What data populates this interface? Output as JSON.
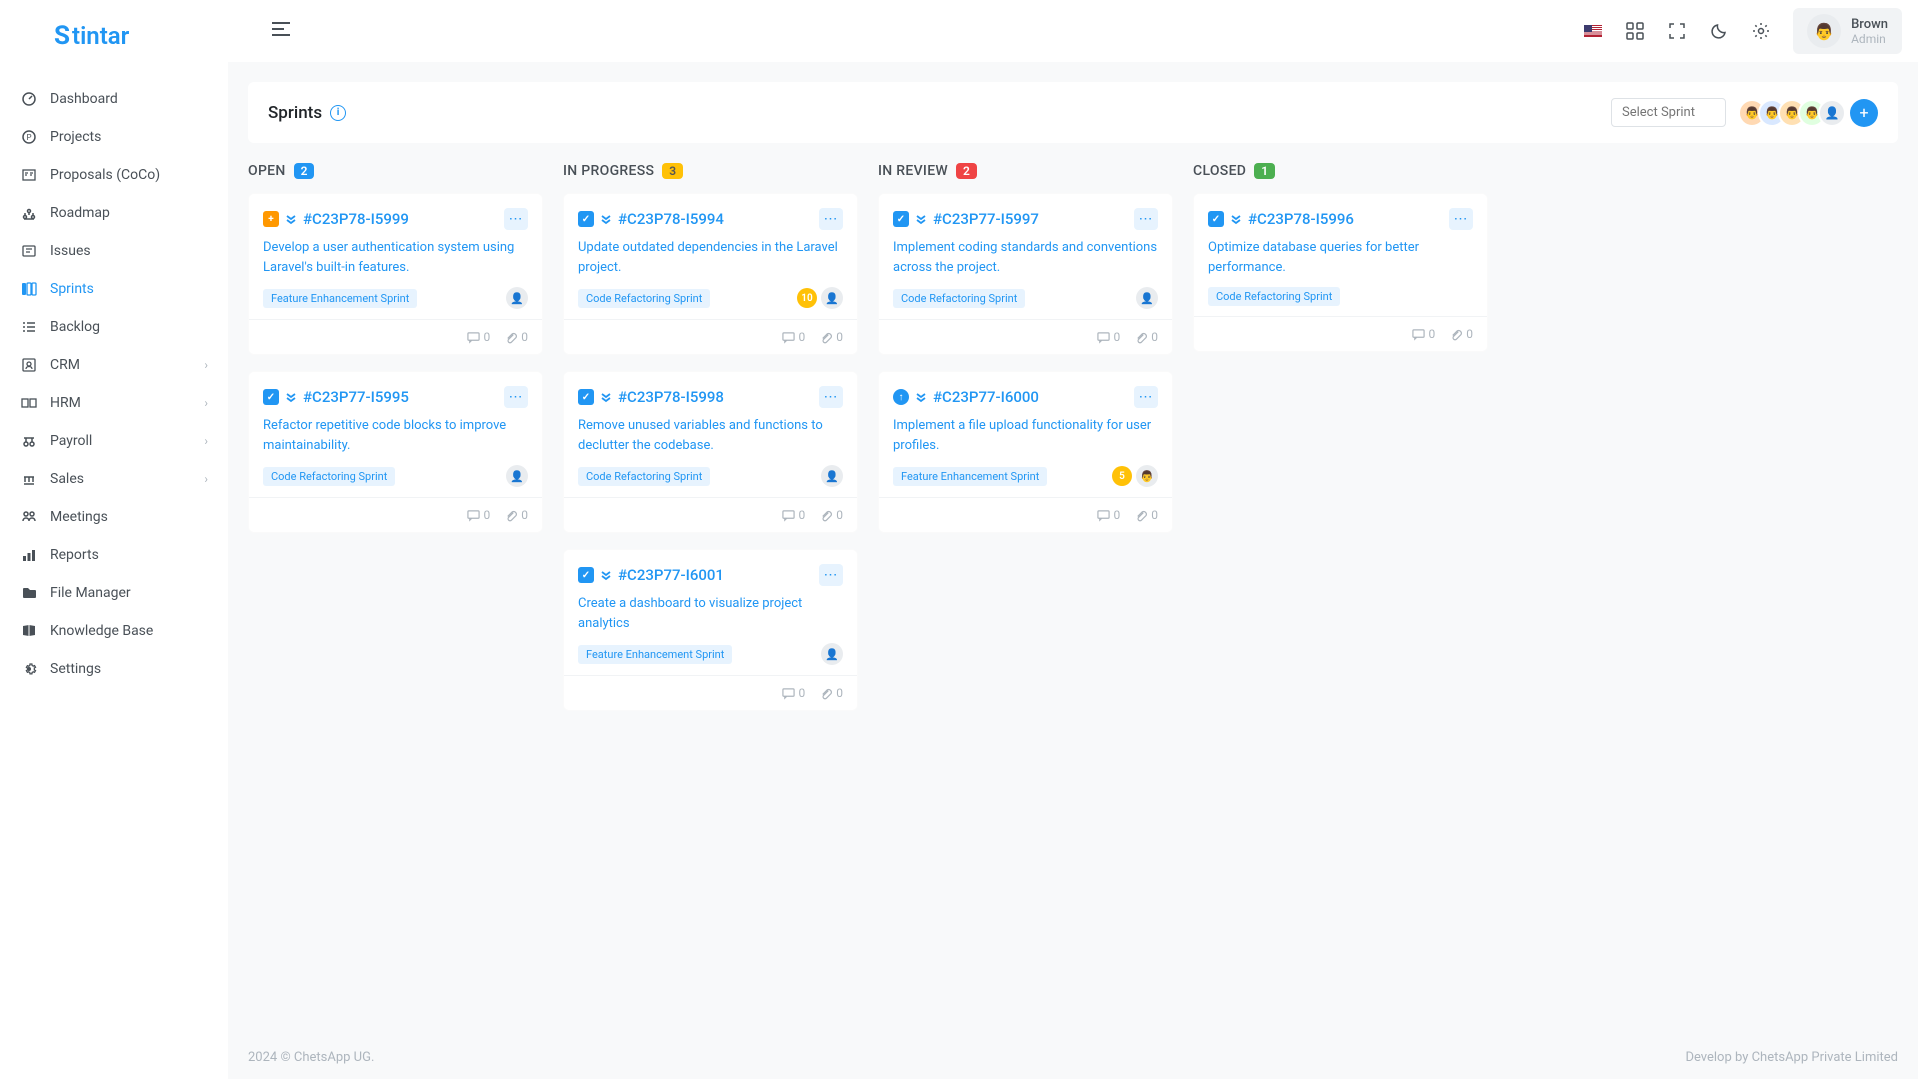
{
  "brand": "Stintar",
  "user": {
    "name": "Brown",
    "role": "Admin"
  },
  "nav": [
    {
      "label": "Dashboard",
      "icon": "dashboard"
    },
    {
      "label": "Projects",
      "icon": "projects"
    },
    {
      "label": "Proposals (CoCo)",
      "icon": "proposal"
    },
    {
      "label": "Roadmap",
      "icon": "roadmap"
    },
    {
      "label": "Issues",
      "icon": "issues"
    },
    {
      "label": "Sprints",
      "icon": "sprints",
      "active": true
    },
    {
      "label": "Backlog",
      "icon": "backlog"
    },
    {
      "label": "CRM",
      "icon": "crm",
      "expand": true
    },
    {
      "label": "HRM",
      "icon": "hrm",
      "expand": true
    },
    {
      "label": "Payroll",
      "icon": "payroll",
      "expand": true
    },
    {
      "label": "Sales",
      "icon": "sales",
      "expand": true
    },
    {
      "label": "Meetings",
      "icon": "meetings"
    },
    {
      "label": "Reports",
      "icon": "reports"
    },
    {
      "label": "File Manager",
      "icon": "file"
    },
    {
      "label": "Knowledge Base",
      "icon": "kb"
    },
    {
      "label": "Settings",
      "icon": "settings"
    }
  ],
  "page": {
    "title": "Sprints",
    "selectPlaceholder": "Select Sprint"
  },
  "columns": [
    {
      "title": "OPEN",
      "count": "2",
      "badge": "b-blue",
      "cards": [
        {
          "id": "#C23P78-I5999",
          "type": "orange",
          "title": "Develop a user authentication system using Laravel's built-in features.",
          "tag": "Feature Enhancement Sprint",
          "assignees": [
            "empty"
          ],
          "comments": "0",
          "attach": "0"
        },
        {
          "id": "#C23P77-I5995",
          "type": "blue",
          "title": "Refactor repetitive code blocks to improve maintainability.",
          "tag": "Code Refactoring Sprint",
          "assignees": [
            "empty"
          ],
          "comments": "0",
          "attach": "0"
        }
      ]
    },
    {
      "title": "IN PROGRESS",
      "count": "3",
      "badge": "b-yellow",
      "cards": [
        {
          "id": "#C23P78-I5994",
          "type": "blue",
          "title": "Update outdated dependencies in the Laravel project.",
          "tag": "Code Refactoring Sprint",
          "points": "10",
          "ptClass": "pt-yellow",
          "assignees": [
            "empty"
          ],
          "comments": "0",
          "attach": "0"
        },
        {
          "id": "#C23P78-I5998",
          "type": "blue",
          "title": "Remove unused variables and functions to declutter the codebase.",
          "tag": "Code Refactoring Sprint",
          "assignees": [
            "empty"
          ],
          "comments": "0",
          "attach": "0"
        },
        {
          "id": "#C23P77-I6001",
          "type": "blue",
          "title": "Create a dashboard to visualize project analytics",
          "tag": "Feature Enhancement Sprint",
          "assignees": [
            "empty"
          ],
          "comments": "0",
          "attach": "0"
        }
      ]
    },
    {
      "title": "IN REVIEW",
      "count": "2",
      "badge": "b-red",
      "cards": [
        {
          "id": "#C23P77-I5997",
          "type": "blue",
          "title": "Implement coding standards and conventions across the project.",
          "tag": "Code Refactoring Sprint",
          "assignees": [
            "empty"
          ],
          "comments": "0",
          "attach": "0"
        },
        {
          "id": "#C23P77-I6000",
          "type": "bluec",
          "title": "Implement a file upload functionality for user profiles.",
          "tag": "Feature Enhancement Sprint",
          "points": "5",
          "ptClass": "pt-yellow",
          "assignees": [
            "user"
          ],
          "comments": "0",
          "attach": "0"
        }
      ]
    },
    {
      "title": "CLOSED",
      "count": "1",
      "badge": "b-green",
      "cards": [
        {
          "id": "#C23P78-I5996",
          "type": "blue",
          "title": "Optimize database queries for better performance.",
          "tag": "Code Refactoring Sprint",
          "comments": "0",
          "attach": "0"
        }
      ]
    }
  ],
  "footer": {
    "left": "2024 © ChetsApp UG.",
    "right": "Develop by ChetsApp Private Limited"
  }
}
